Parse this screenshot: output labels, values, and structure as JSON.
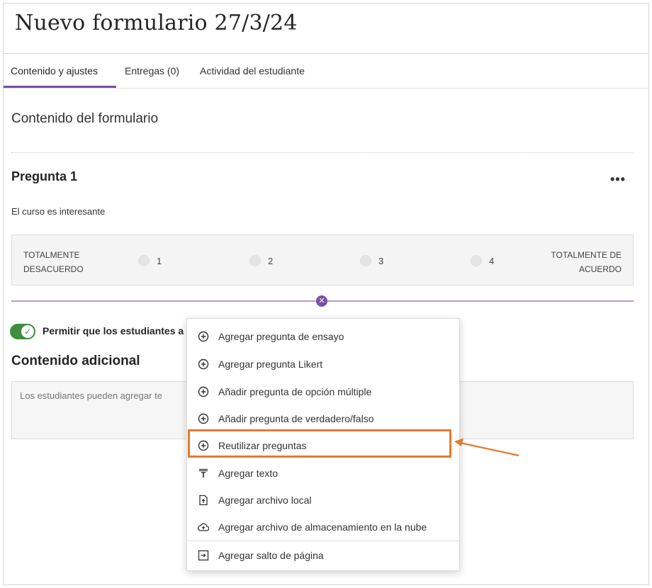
{
  "page": {
    "title": "Nuevo formulario 27/3/24"
  },
  "tabs": [
    {
      "label": "Contenido y ajustes",
      "active": true
    },
    {
      "label": "Entregas (0)",
      "active": false
    },
    {
      "label": "Actividad del estudiante",
      "active": false
    }
  ],
  "content": {
    "section_title": "Contenido del formulario",
    "question": {
      "title": "Pregunta 1",
      "more_label": "•••",
      "text": "El curso es interesante",
      "likert": {
        "left_label_line1": "TOTALMENTE",
        "left_label_line2": "DESACUERDO",
        "right_label_line1": "TOTALMENTE DE",
        "right_label_line2": "ACUERDO",
        "options": [
          "1",
          "2",
          "3",
          "4"
        ]
      }
    },
    "toggle": {
      "label": "Permitir que los estudiantes a",
      "checked": true
    },
    "additional": {
      "title": "Contenido adicional",
      "placeholder": "Los estudiantes pueden agregar te"
    }
  },
  "menu": {
    "items": [
      {
        "label": "Agregar pregunta de ensayo",
        "icon": "plus-circle-icon"
      },
      {
        "label": "Agregar pregunta Likert",
        "icon": "plus-circle-icon"
      },
      {
        "label": "Añadir pregunta de opción múltiple",
        "icon": "plus-circle-icon"
      },
      {
        "label": "Añadir pregunta de verdadero/falso",
        "icon": "plus-circle-icon"
      },
      {
        "label": "Reutilizar preguntas",
        "icon": "plus-circle-icon",
        "highlighted": true
      },
      {
        "label": "Agregar texto",
        "icon": "text-icon"
      },
      {
        "label": "Agregar archivo local",
        "icon": "file-upload-icon"
      },
      {
        "label": "Agregar archivo de almacenamiento en la nube",
        "icon": "cloud-upload-icon"
      },
      {
        "label": "Agregar salto de página",
        "icon": "page-break-icon"
      }
    ]
  },
  "colors": {
    "accent_purple": "#7b4fa2",
    "toggle_green": "#3e8e3e",
    "highlight_orange": "#e07b32"
  }
}
